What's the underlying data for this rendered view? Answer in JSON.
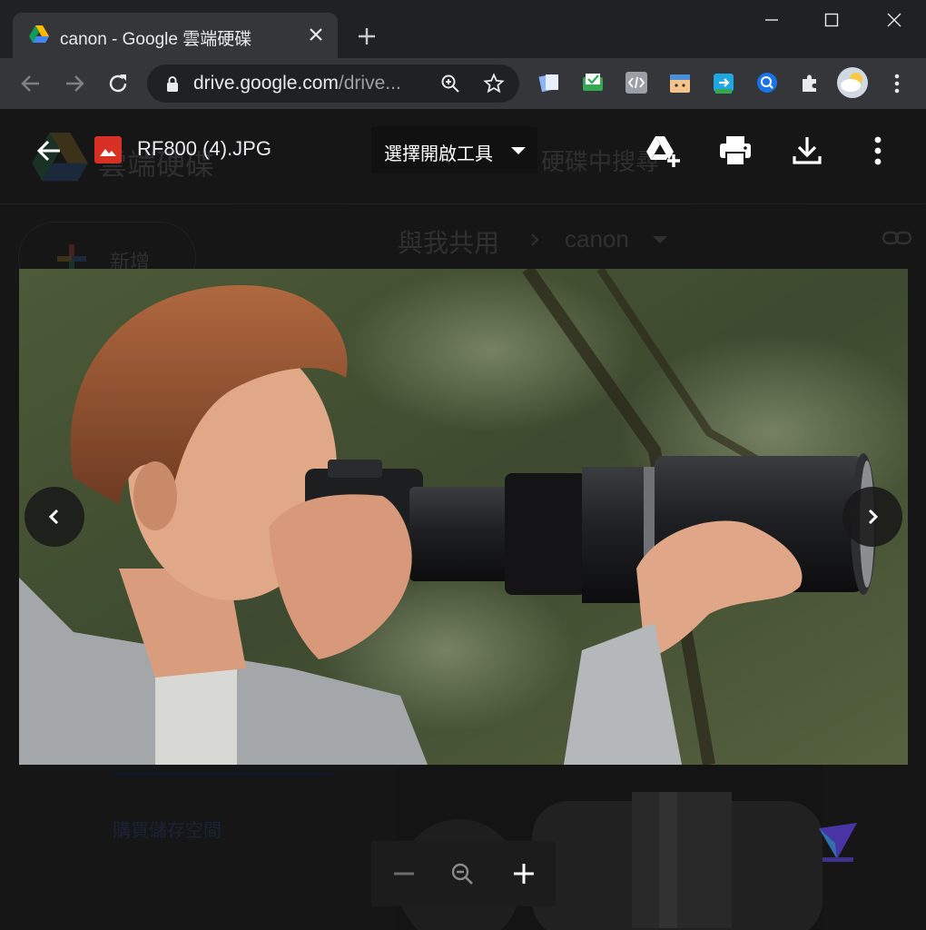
{
  "browser": {
    "tab": {
      "title": "canon - Google 雲端硬碟",
      "favicon": "google-drive-icon"
    },
    "url": {
      "host": "drive.google.com",
      "path": "/drive..."
    },
    "extensions": [
      "notes-extension-icon",
      "mail-check-extension-icon",
      "code-extension-icon",
      "tofu-extension-icon",
      "share-extension-icon",
      "search-extension-icon",
      "puzzle-extensions-icon"
    ]
  },
  "background_page": {
    "app_name": "雲端硬碟",
    "search_placeholder": "硬碟中搜尋",
    "new_button": "新增",
    "breadcrumb_parent": "與我共用",
    "breadcrumb_current": "canon",
    "storage_link": "購買儲存空間"
  },
  "viewer": {
    "file_name": "RF800 (4).JPG",
    "open_with_label": "選擇開啟工具",
    "actions": [
      "add-to-drive-icon",
      "print-icon",
      "download-icon",
      "more-vert-icon"
    ],
    "photo_description_icon": "photo-of-man-with-telephoto-lens",
    "zoom": {
      "out": "zoom-out-icon",
      "reset": "zoom-reset-icon",
      "in": "zoom-in-icon"
    }
  },
  "colors": {
    "chrome_dark": "#202124",
    "chrome_toolbar": "#35363a",
    "viewer_bg": "#161616",
    "image_icon_red": "#d93025"
  }
}
